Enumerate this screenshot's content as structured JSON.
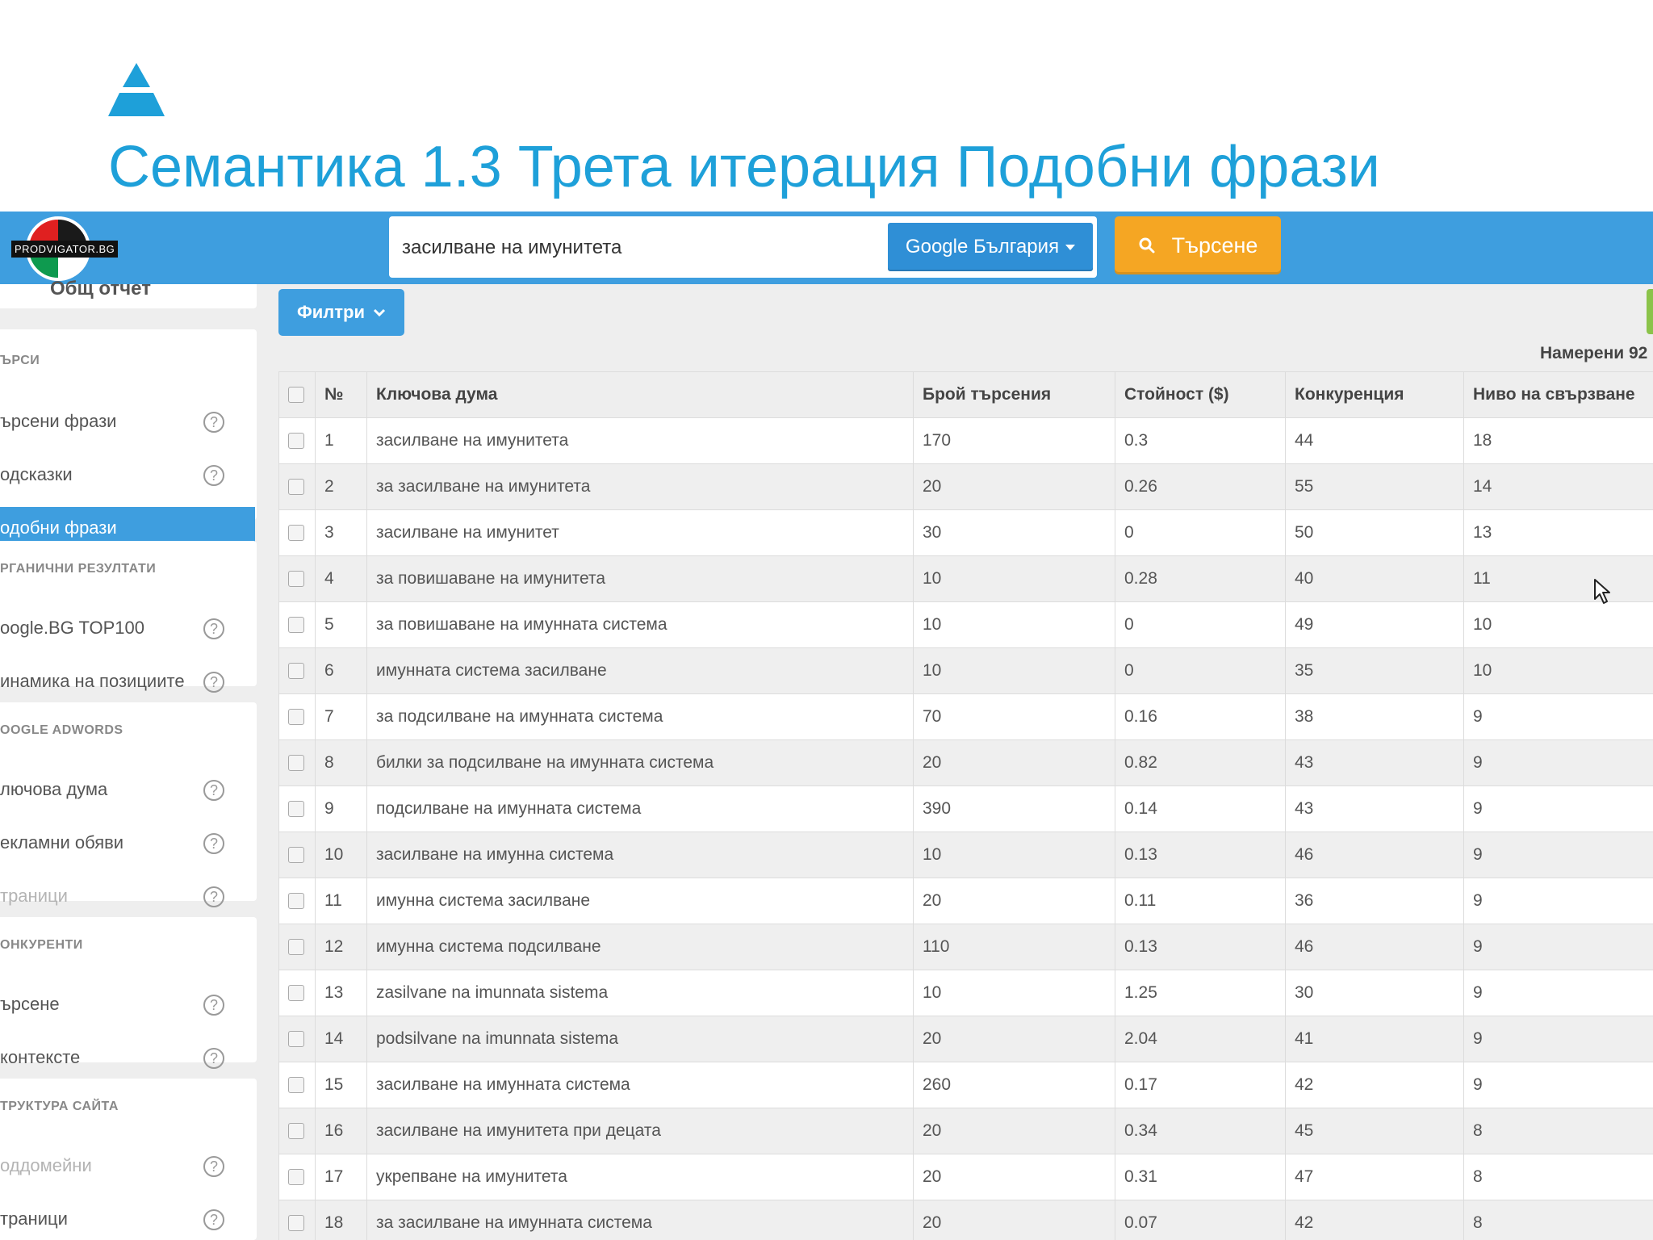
{
  "slide": {
    "title": "Семантика 1.3 Трета итерация Подобни фрази"
  },
  "topbar": {
    "brand": "PRODVIGATOR.BG",
    "search_value": "засилване на имунитета",
    "engine_label": "Google България",
    "search_button": "Търсене"
  },
  "sidebar": {
    "overview_label": "Общ отчет",
    "sections": [
      {
        "title": "ЪРСИ",
        "items": [
          {
            "label": "ърсени фрази",
            "state": "normal"
          },
          {
            "label": "одсказки",
            "state": "normal"
          },
          {
            "label": "одобни фрази",
            "state": "active"
          }
        ]
      },
      {
        "title": "РГАНИЧНИ РЕЗУЛТАТИ",
        "items": [
          {
            "label": "oogle.BG TOP100",
            "state": "normal"
          },
          {
            "label": "инамика на позициите",
            "state": "normal"
          }
        ]
      },
      {
        "title": "OOGLE ADWORDS",
        "items": [
          {
            "label": "лючова дума",
            "state": "normal"
          },
          {
            "label": "екламни обяви",
            "state": "normal"
          },
          {
            "label": "траници",
            "state": "disabled"
          }
        ]
      },
      {
        "title": "ОНКУРЕНТИ",
        "items": [
          {
            "label": "ърсене",
            "state": "normal"
          },
          {
            "label": "контексте",
            "state": "normal"
          }
        ]
      },
      {
        "title": "ТРУКТУРА САЙТА",
        "items": [
          {
            "label": "оддомейни",
            "state": "disabled"
          },
          {
            "label": "траници",
            "state": "normal"
          }
        ]
      }
    ],
    "help_glyph": "?"
  },
  "main": {
    "filters_label": "Филтри",
    "found_label": "Намерени 92"
  },
  "table": {
    "headers": [
      "№",
      "Ключова дума",
      "Брой търсения",
      "Стойност ($)",
      "Конкуренция",
      "Ниво на свързване"
    ],
    "rows": [
      [
        "1",
        "засилване на имунитета",
        "170",
        "0.3",
        "44",
        "18"
      ],
      [
        "2",
        "за засилване на имунитета",
        "20",
        "0.26",
        "55",
        "14"
      ],
      [
        "3",
        "засилване на имунитет",
        "30",
        "0",
        "50",
        "13"
      ],
      [
        "4",
        "за повишаване на имунитета",
        "10",
        "0.28",
        "40",
        "11"
      ],
      [
        "5",
        "за повишаване на имунната система",
        "10",
        "0",
        "49",
        "10"
      ],
      [
        "6",
        "имунната система засилване",
        "10",
        "0",
        "35",
        "10"
      ],
      [
        "7",
        "за подсилване на имунната система",
        "70",
        "0.16",
        "38",
        "9"
      ],
      [
        "8",
        "билки за подсилване на имунната система",
        "20",
        "0.82",
        "43",
        "9"
      ],
      [
        "9",
        "подсилване на имунната система",
        "390",
        "0.14",
        "43",
        "9"
      ],
      [
        "10",
        "засилване на имунна система",
        "10",
        "0.13",
        "46",
        "9"
      ],
      [
        "11",
        "имунна система засилване",
        "20",
        "0.11",
        "36",
        "9"
      ],
      [
        "12",
        "имунна система подсилване",
        "110",
        "0.13",
        "46",
        "9"
      ],
      [
        "13",
        "zasilvane na imunnata sistema",
        "10",
        "1.25",
        "30",
        "9"
      ],
      [
        "14",
        "podsilvane na imunnata sistema",
        "20",
        "2.04",
        "41",
        "9"
      ],
      [
        "15",
        "засилване на имунната система",
        "260",
        "0.17",
        "42",
        "9"
      ],
      [
        "16",
        "засилване на имунитета при децата",
        "20",
        "0.34",
        "45",
        "8"
      ],
      [
        "17",
        "укрепване на имунитета",
        "20",
        "0.31",
        "47",
        "8"
      ],
      [
        "18",
        "за засилване на имунната система",
        "20",
        "0.07",
        "42",
        "8"
      ]
    ]
  },
  "colors": {
    "accent": "#1ea0d9",
    "topbar": "#3e9edf",
    "search_button": "#f5a623",
    "active_item": "#3e9edf"
  },
  "icons": {
    "logo": "triangle-logo-icon",
    "search": "search-icon",
    "dropdown": "chevron-down-icon",
    "help": "question-circle-icon",
    "cursor": "mouse-cursor-icon"
  }
}
